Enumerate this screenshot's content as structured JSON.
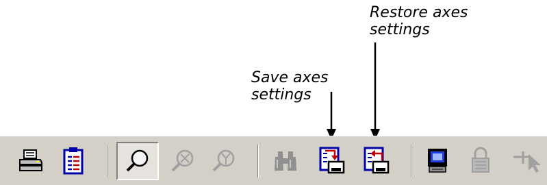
{
  "annotations": {
    "restore": {
      "line1": "Restore axes",
      "line2": "settings"
    },
    "save": {
      "line1": "Save axes",
      "line2": "settings"
    }
  },
  "toolbar": {
    "background": "#d4d0c8",
    "buttons": [
      {
        "id": "print",
        "icon": "printer-icon",
        "enabled": true
      },
      {
        "id": "copy-options",
        "icon": "clipboard-icon",
        "enabled": true
      },
      {
        "id": "zoom-in",
        "icon": "magnifier-zoom-icon",
        "enabled": true,
        "pressed": true
      },
      {
        "id": "zoom-x",
        "icon": "magnifier-x-icon",
        "enabled": false
      },
      {
        "id": "zoom-y",
        "icon": "magnifier-y-icon",
        "enabled": false
      },
      {
        "id": "find",
        "icon": "binoculars-icon",
        "enabled": false
      },
      {
        "id": "save-axes",
        "icon": "save-axes-icon",
        "enabled": true
      },
      {
        "id": "restore-axes",
        "icon": "restore-axes-icon",
        "enabled": true
      },
      {
        "id": "display",
        "icon": "monitor-icon",
        "enabled": true
      },
      {
        "id": "lock",
        "icon": "lock-icon",
        "enabled": false
      },
      {
        "id": "cursor",
        "icon": "cursor-icon",
        "enabled": false
      }
    ]
  },
  "colors": {
    "blue": "#0000a8",
    "red": "#c00000",
    "disabled": "#a0a0a0",
    "black": "#000000"
  }
}
